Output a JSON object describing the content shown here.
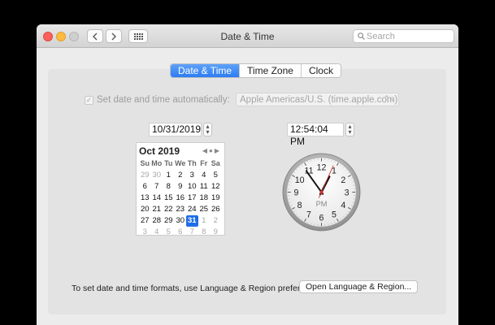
{
  "window": {
    "title": "Date & Time",
    "search_placeholder": "Search"
  },
  "tabs": [
    {
      "label": "Date & Time",
      "active": true
    },
    {
      "label": "Time Zone",
      "active": false
    },
    {
      "label": "Clock",
      "active": false
    }
  ],
  "auto": {
    "checkbox_label": "Set date and time automatically:",
    "checked": true,
    "enabled": false,
    "server": "Apple Americas/U.S. (time.apple.com)"
  },
  "date_field": "10/31/2019",
  "time_field": "12:54:04 PM",
  "calendar": {
    "month_label": "Oct 2019",
    "weekdays": [
      "Su",
      "Mo",
      "Tu",
      "We",
      "Th",
      "Fr",
      "Sa"
    ],
    "days": [
      {
        "n": "29",
        "dim": true
      },
      {
        "n": "30",
        "dim": true
      },
      {
        "n": "1"
      },
      {
        "n": "2"
      },
      {
        "n": "3"
      },
      {
        "n": "4"
      },
      {
        "n": "5"
      },
      {
        "n": "6"
      },
      {
        "n": "7"
      },
      {
        "n": "8"
      },
      {
        "n": "9"
      },
      {
        "n": "10"
      },
      {
        "n": "11"
      },
      {
        "n": "12"
      },
      {
        "n": "13"
      },
      {
        "n": "14"
      },
      {
        "n": "15"
      },
      {
        "n": "16"
      },
      {
        "n": "17"
      },
      {
        "n": "18"
      },
      {
        "n": "19"
      },
      {
        "n": "20"
      },
      {
        "n": "21"
      },
      {
        "n": "22"
      },
      {
        "n": "23"
      },
      {
        "n": "24"
      },
      {
        "n": "25"
      },
      {
        "n": "26"
      },
      {
        "n": "27"
      },
      {
        "n": "28"
      },
      {
        "n": "29"
      },
      {
        "n": "30"
      },
      {
        "n": "31",
        "selected": true
      },
      {
        "n": "1",
        "dim": true
      },
      {
        "n": "2",
        "dim": true
      },
      {
        "n": "3",
        "dim": true
      },
      {
        "n": "4",
        "dim": true
      },
      {
        "n": "5",
        "dim": true
      },
      {
        "n": "6",
        "dim": true
      },
      {
        "n": "7",
        "dim": true
      },
      {
        "n": "8",
        "dim": true
      },
      {
        "n": "9",
        "dim": true
      }
    ]
  },
  "clock": {
    "numbers": [
      "12",
      "1",
      "2",
      "3",
      "4",
      "5",
      "6",
      "7",
      "8",
      "9",
      "10",
      "11"
    ],
    "meridiem": "PM",
    "hour": 12,
    "minute": 54,
    "second": 4
  },
  "footer": {
    "text": "To set date and time formats, use Language & Region preferences.",
    "button_label": "Open Language & Region..."
  },
  "colors": {
    "accent": "#2c7cf2",
    "selected_day": "#1e6ee6",
    "second_hand": "#d0312d"
  },
  "icons": {
    "search": "search-icon",
    "back": "chevron-left-icon",
    "forward": "chevron-right-icon",
    "show_all": "grid-icon"
  }
}
